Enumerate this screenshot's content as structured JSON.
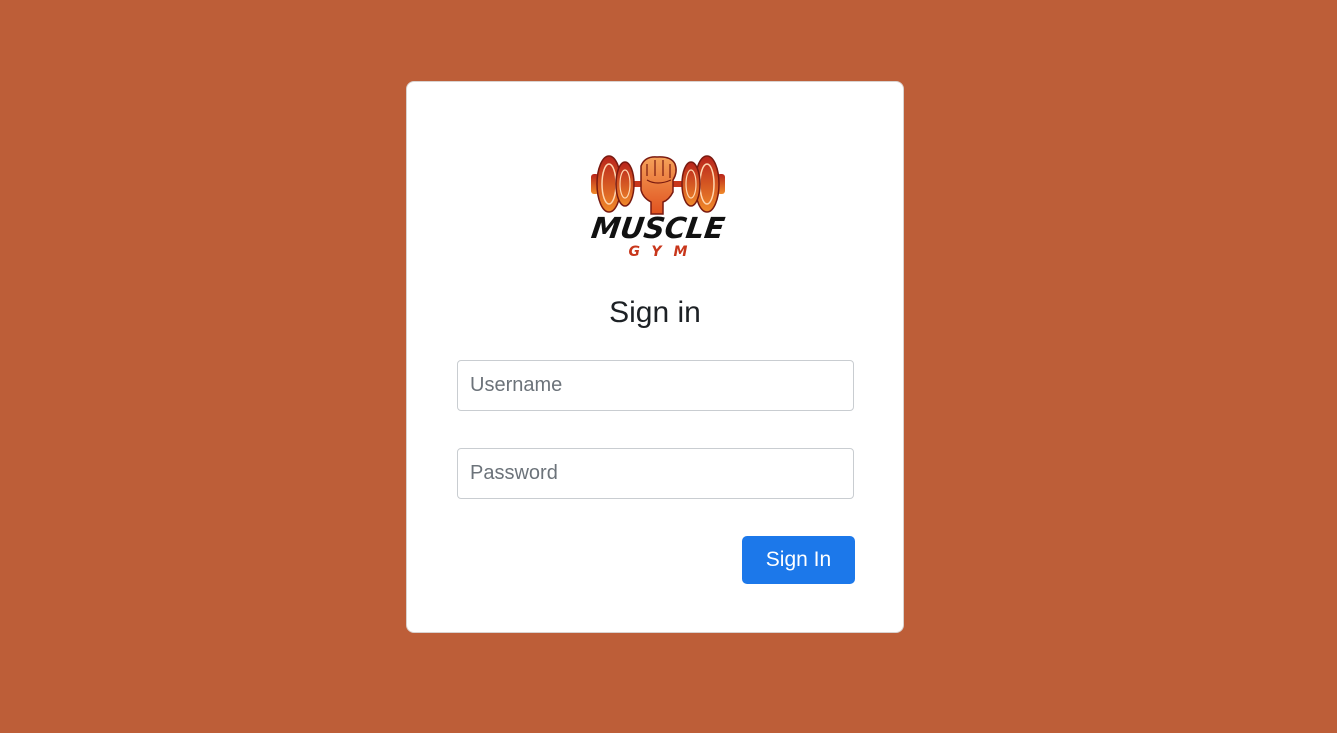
{
  "page": {
    "background_color": "#bd5e38"
  },
  "logo": {
    "wordmark": "MUSCLE",
    "subword": "GYM",
    "icon": "dumbbell-fist-icon",
    "accent_color": "#e0521f"
  },
  "form": {
    "title": "Sign in",
    "username_placeholder": "Username",
    "password_placeholder": "Password",
    "submit_label": "Sign In",
    "submit_color": "#1c78ea"
  }
}
